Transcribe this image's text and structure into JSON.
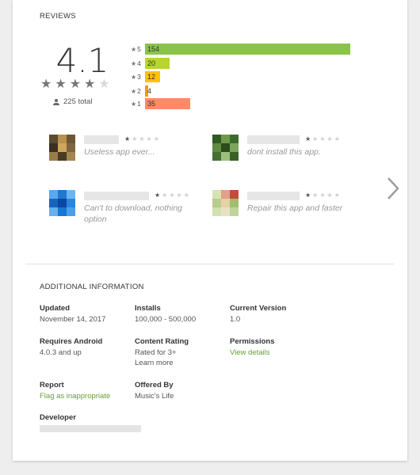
{
  "reviews": {
    "title": "REVIEWS",
    "score": "4.1",
    "total": "225 total",
    "stars_filled": 4,
    "histogram": [
      {
        "star": "5",
        "count": "154",
        "color": "#8bc34a"
      },
      {
        "star": "4",
        "count": "20",
        "color": "#b7d52e"
      },
      {
        "star": "3",
        "count": "12",
        "color": "#ffc107"
      },
      {
        "star": "2",
        "count": "4",
        "color": "#ff9800"
      },
      {
        "star": "1",
        "count": "35",
        "color": "#ff8a65"
      }
    ],
    "items": [
      {
        "rating": 1,
        "text": "Useless app ever..."
      },
      {
        "rating": 1,
        "text": "dont install this app."
      },
      {
        "rating": 1,
        "text": "Can't to download, nothing option"
      },
      {
        "rating": 1,
        "text": "Repair this app and faster"
      }
    ],
    "next_icon": "chevron-right-icon"
  },
  "additional": {
    "title": "ADDITIONAL INFORMATION",
    "updated_label": "Updated",
    "updated_value": "November 14, 2017",
    "installs_label": "Installs",
    "installs_value": "100,000 - 500,000",
    "version_label": "Current Version",
    "version_value": "1.0",
    "android_label": "Requires Android",
    "android_value": "4.0.3 and up",
    "content_label": "Content Rating",
    "content_value": "Rated for 3+",
    "content_link": "Learn more",
    "permissions_label": "Permissions",
    "permissions_link": "View details",
    "report_label": "Report",
    "report_link": "Flag as inappropriate",
    "offered_label": "Offered By",
    "offered_value": "Music's Life",
    "developer_label": "Developer"
  }
}
